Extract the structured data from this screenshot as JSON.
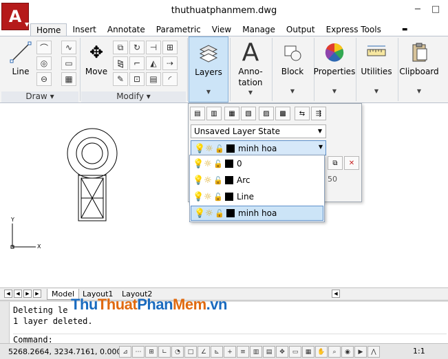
{
  "window": {
    "title": "thuthuatphanmem.dwg",
    "app_logo": "A",
    "minimize": "−",
    "maximize": "□"
  },
  "tabs": [
    {
      "label": "Home",
      "active": true
    },
    {
      "label": "Insert"
    },
    {
      "label": "Annotate"
    },
    {
      "label": "Parametric"
    },
    {
      "label": "View"
    },
    {
      "label": "Manage"
    },
    {
      "label": "Output"
    },
    {
      "label": "Express Tools"
    }
  ],
  "ribbon": {
    "line": "Line",
    "move": "Move",
    "layers": "Layers",
    "annotation_1": "Anno-",
    "annotation_2": "tation",
    "block": "Block",
    "properties": "Properties",
    "utilities": "Utilities",
    "clipboard": "Clipboard",
    "draw_panel": "Draw",
    "modify_panel": "Modify"
  },
  "layers_popup": {
    "state": "Unsaved Layer State",
    "current_layer": "minh hoa",
    "items": [
      "0",
      "Arc",
      "Line",
      "minh hoa"
    ],
    "number_field": "50"
  },
  "drawing": {
    "ucs_y": "Y",
    "ucs_x": "X"
  },
  "layout_tabs": [
    "Model",
    "Layout1",
    "Layout2"
  ],
  "command": {
    "line1": "Deleting layer \"...\"",
    "line1_visible": "Deleting le",
    "line2": "1 layer deleted.",
    "prompt": "Command:"
  },
  "watermark": {
    "p1": "Thu",
    "p2": "Thuat",
    "p3": "Phan",
    "p4": "Mem",
    "p5": ".vn"
  },
  "status": {
    "coords": "5268.2664, 3234.7161, 0.0000",
    "scale": "1:1"
  },
  "colors": {
    "accent": "#b51a1a",
    "selection": "#cce4f7"
  }
}
